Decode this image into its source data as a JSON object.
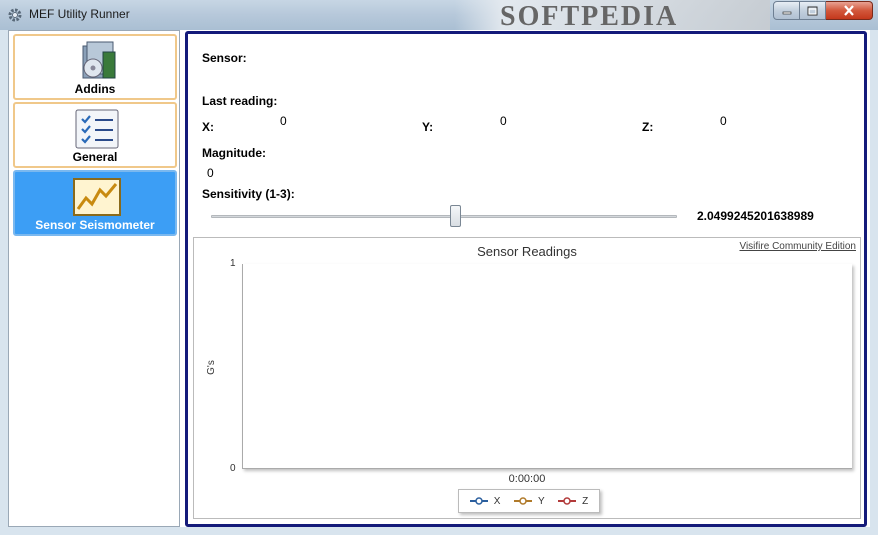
{
  "window": {
    "title": "MEF Utility Runner",
    "watermark": "SOFTPEDIA"
  },
  "sidebar": {
    "items": [
      {
        "label": "Addins",
        "icon": "addins-box-icon",
        "active": false
      },
      {
        "label": "General",
        "icon": "checklist-icon",
        "active": false
      },
      {
        "label": "Sensor Seismometer",
        "icon": "line-chart-icon",
        "active": true
      }
    ]
  },
  "sensor": {
    "sensor_label": "Sensor:",
    "last_reading_label": "Last reading:",
    "x_label": "X:",
    "x_value": "0",
    "y_label": "Y:",
    "y_value": "0",
    "z_label": "Z:",
    "z_value": "0",
    "magnitude_label": "Magnitude:",
    "magnitude_value": "0",
    "sensitivity_label": "Sensitivity (1-3):",
    "sensitivity_value": "2.0499245201638989",
    "sensitivity_min": 1,
    "sensitivity_max": 3,
    "sensitivity": 2.049924520163899
  },
  "chart": {
    "watermark": "Visifire Community Edition"
  },
  "chart_data": {
    "type": "line",
    "title": "Sensor Readings",
    "xlabel": "",
    "ylabel": "G's",
    "x": [
      "0:00:00"
    ],
    "ylim": [
      0,
      1
    ],
    "yticks": [
      "1",
      "0"
    ],
    "series": [
      {
        "name": "X",
        "values": [],
        "color": "#2b5f9e"
      },
      {
        "name": "Y",
        "values": [],
        "color": "#b07a2a"
      },
      {
        "name": "Z",
        "values": [],
        "color": "#b23a3a"
      }
    ],
    "legend": "bottom"
  },
  "colors": {
    "accent": "#3c9ef5",
    "frame": "#141a7a",
    "nav_border": "#f0c88a"
  }
}
